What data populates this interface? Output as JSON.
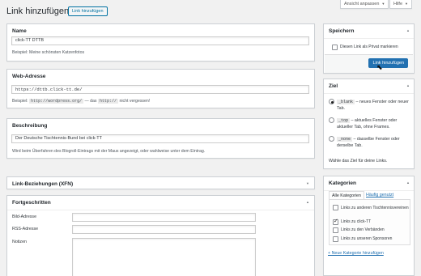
{
  "header": {
    "title": "Link hinzufügen",
    "add_new_label": "Link hinzufügen",
    "screen_options_label": "Ansicht anpassen",
    "help_label": "Hilfe"
  },
  "name_box": {
    "heading": "Name",
    "value": "click-TT DTTB",
    "description": "Beispiel: Meine schönsten Katzenfotos"
  },
  "url_box": {
    "heading": "Web-Adresse",
    "value": "https://dttb.click-tt.de/",
    "desc_prefix": "Beispiel:",
    "desc_code1": "http://wordpress.org/",
    "desc_mid": "— das",
    "desc_code2": "http://",
    "desc_suffix": "nicht vergessen!"
  },
  "description_box": {
    "heading": "Beschreibung",
    "value": "Der Deutsche Tischtennis-Bund bei click-TT",
    "description": "Wird beim Überfahren des Blogroll-Eintrags mit der Maus angezeigt, oder wahlweise unter dem Eintrag."
  },
  "xfn_box": {
    "heading": "Link-Beziehungen (XFN)"
  },
  "advanced_box": {
    "heading": "Fortgeschritten",
    "image_label": "Bild-Adresse",
    "rss_label": "RSS-Adresse",
    "notes_label": "Notizen"
  },
  "save_box": {
    "heading": "Speichern",
    "private_label": "Diesen Link als Privat markieren",
    "submit_label": "Link hinzufügen"
  },
  "target_box": {
    "heading": "Ziel",
    "options": [
      {
        "code": "_blank",
        "text": "– neues Fenster oder neuer Tab.",
        "selected": true
      },
      {
        "code": "_top",
        "text": "– aktuelles Fenster oder aktueller Tab, ohne Frames.",
        "selected": false
      },
      {
        "code": "_none",
        "text": "– dasselbe Fenster oder derselbe Tab.",
        "selected": false
      }
    ],
    "footer": "Wähle das Ziel für deine Links."
  },
  "categories_box": {
    "heading": "Kategorien",
    "tab_all": "Alle Kategorien",
    "tab_popular": "Häufig genutzt",
    "items": [
      {
        "label": "Links zu anderen Tischtennisvereinen",
        "checked": false
      },
      {
        "label": "Links zu click-TT",
        "checked": true
      },
      {
        "label": "Links zu den Verbänden",
        "checked": false
      },
      {
        "label": "Links zu unseren Sponsoren",
        "checked": false
      }
    ],
    "add_new": "+ Neue Kategorie hinzufügen"
  },
  "icons": [
    "chevron-up-icon",
    "chevron-down-icon",
    "caret-down-icon",
    "checkmark-icon",
    "mouse-cursor-icon"
  ],
  "colors": {
    "accent": "#2271b1",
    "background": "#f1f1f1",
    "border": "#ccd0d4"
  }
}
